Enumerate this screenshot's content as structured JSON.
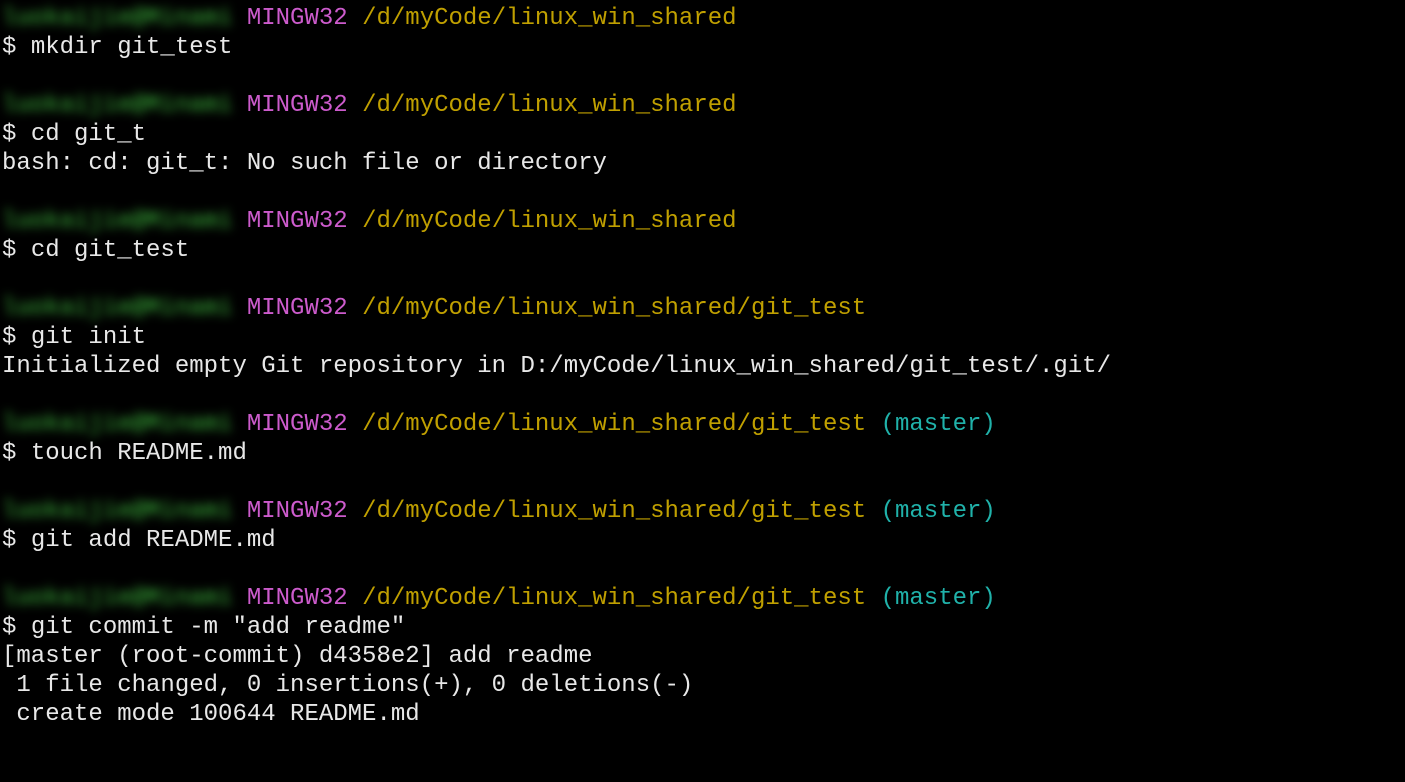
{
  "user": "luokaijie@Minami",
  "env": "MINGW32",
  "path1": "/d/myCode/linux_win_shared",
  "path2": "/d/myCode/linux_win_shared/git_test",
  "branch": "(master)",
  "entries": [
    {
      "path": "path1",
      "branch": false,
      "cmd": "mkdir git_test",
      "out": []
    },
    {
      "path": "path1",
      "branch": false,
      "cmd": "cd git_t",
      "out": [
        "bash: cd: git_t: No such file or directory"
      ]
    },
    {
      "path": "path1",
      "branch": false,
      "cmd": "cd git_test",
      "out": []
    },
    {
      "path": "path2",
      "branch": false,
      "cmd": "git init",
      "out": [
        "Initialized empty Git repository in D:/myCode/linux_win_shared/git_test/.git/"
      ]
    },
    {
      "path": "path2",
      "branch": true,
      "cmd": "touch README.md",
      "out": []
    },
    {
      "path": "path2",
      "branch": true,
      "cmd": "git add README.md",
      "out": []
    },
    {
      "path": "path2",
      "branch": true,
      "cmd": "git commit -m \"add readme\"",
      "out": [
        "[master (root-commit) d4358e2] add readme",
        " 1 file changed, 0 insertions(+), 0 deletions(-)",
        " create mode 100644 README.md"
      ]
    }
  ]
}
